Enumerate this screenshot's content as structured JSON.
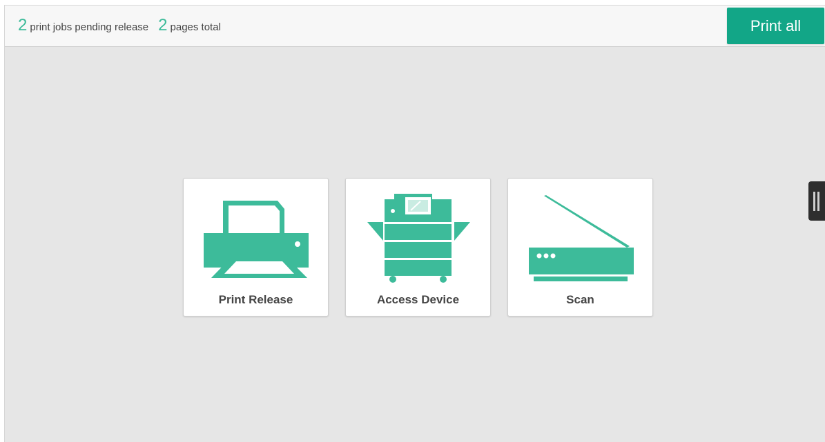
{
  "summary": {
    "jobs_count": "2",
    "jobs_label": "print jobs pending release",
    "pages_count": "2",
    "pages_label": "pages total"
  },
  "toolbar": {
    "print_all_label": "Print all"
  },
  "tiles": [
    {
      "label": "Print Release",
      "icon": "printer-icon"
    },
    {
      "label": "Access Device",
      "icon": "copier-icon"
    },
    {
      "label": "Scan",
      "icon": "scanner-icon"
    }
  ],
  "sidebar_toggle": {
    "icon": "panel-handle-icon"
  },
  "colors": {
    "accent": "#3dbb9a",
    "button": "#12a687",
    "background": "#e6e6e6",
    "topbar": "#f7f7f7",
    "handle": "#2e2e2e"
  }
}
